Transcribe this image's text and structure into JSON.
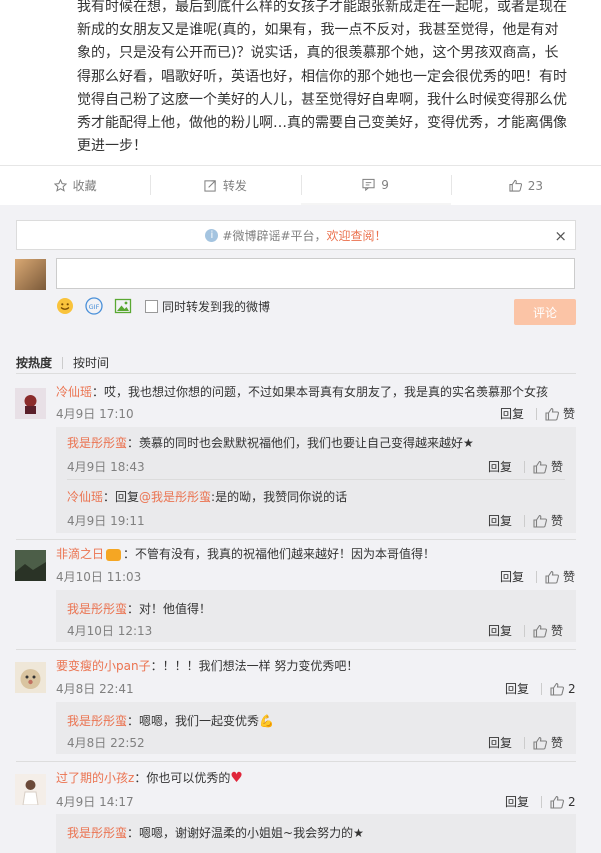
{
  "post": {
    "text": "我有时候在想，最后到底什么样的女孩子才能跟张新成走在一起呢，或者是现在新成的女朋友又是谁呢(真的，如果有，我一点不反对，我甚至觉得，他是有对象的，只是没有公开而已)？说实话，真的很羡慕那个她，这个男孩双商高，长得那么好看，唱歌好听，英语也好，相信你的那个她也一定会很优秀的吧！有时觉得自己粉了这麽一个美好的人儿，甚至觉得好自卑啊，我什么时候变得那么优秀才能配得上他，做他的粉儿啊…真的需要自己变美好，变得优秀，才能离偶像更进一步！"
  },
  "actions": {
    "favorite": "收藏",
    "repost": "转发",
    "comment_count": "9",
    "like_count": "23"
  },
  "notice": {
    "prefix": "#微博辟谣#平台，",
    "highlight": "欢迎查阅！",
    "close": "×"
  },
  "composer": {
    "sync_label": "同时转发到我的微博",
    "submit": "评论"
  },
  "sort": {
    "by_hot": "按热度",
    "by_time": "按时间"
  },
  "ops": {
    "reply": "回复",
    "like": "赞"
  },
  "comments": [
    {
      "name": "冷仙瑶",
      "text": "：哎，我也想过你想的问题，不过如果本哥真有女朋友了，我是真的实名羡慕那个女孩",
      "time": "4月9日 17:10",
      "replies": [
        {
          "name": "我是彤彤蛮",
          "text": "：羡慕的同时也会默默祝福他们，我们也要让自己变得越来越好",
          "time": "4月9日 18:43"
        },
        {
          "name": "冷仙瑶",
          "reply_prefix": "：回复",
          "reply_to": "@我是彤彤蛮",
          "text": ":是的呦，我赞同你说的话",
          "time": "4月9日 19:11"
        }
      ]
    },
    {
      "name": "非滴之日",
      "text": "：不管有没有，我真的祝福他们越来越好！因为本哥值得！",
      "time": "4月10日 11:03",
      "replies": [
        {
          "name": "我是彤彤蛮",
          "text": "：对！他值得！",
          "time": "4月10日 12:13"
        }
      ]
    },
    {
      "name": "要变瘦的小pan子",
      "text": "：！！！我们想法一样 努力变优秀吧！",
      "time": "4月8日 22:41",
      "like_count": "2",
      "replies": [
        {
          "name": "我是彤彤蛮",
          "text": "：嗯嗯，我们一起变优秀",
          "time": "4月8日 22:52"
        }
      ]
    },
    {
      "name": "过了期的小孩z",
      "text": "：你也可以优秀的",
      "time": "4月9日 14:17",
      "like_count": "2",
      "replies": [
        {
          "name": "我是彤彤蛮",
          "text": "：嗯嗯，谢谢好温柔的小姐姐~我会努力的"
        }
      ]
    }
  ]
}
